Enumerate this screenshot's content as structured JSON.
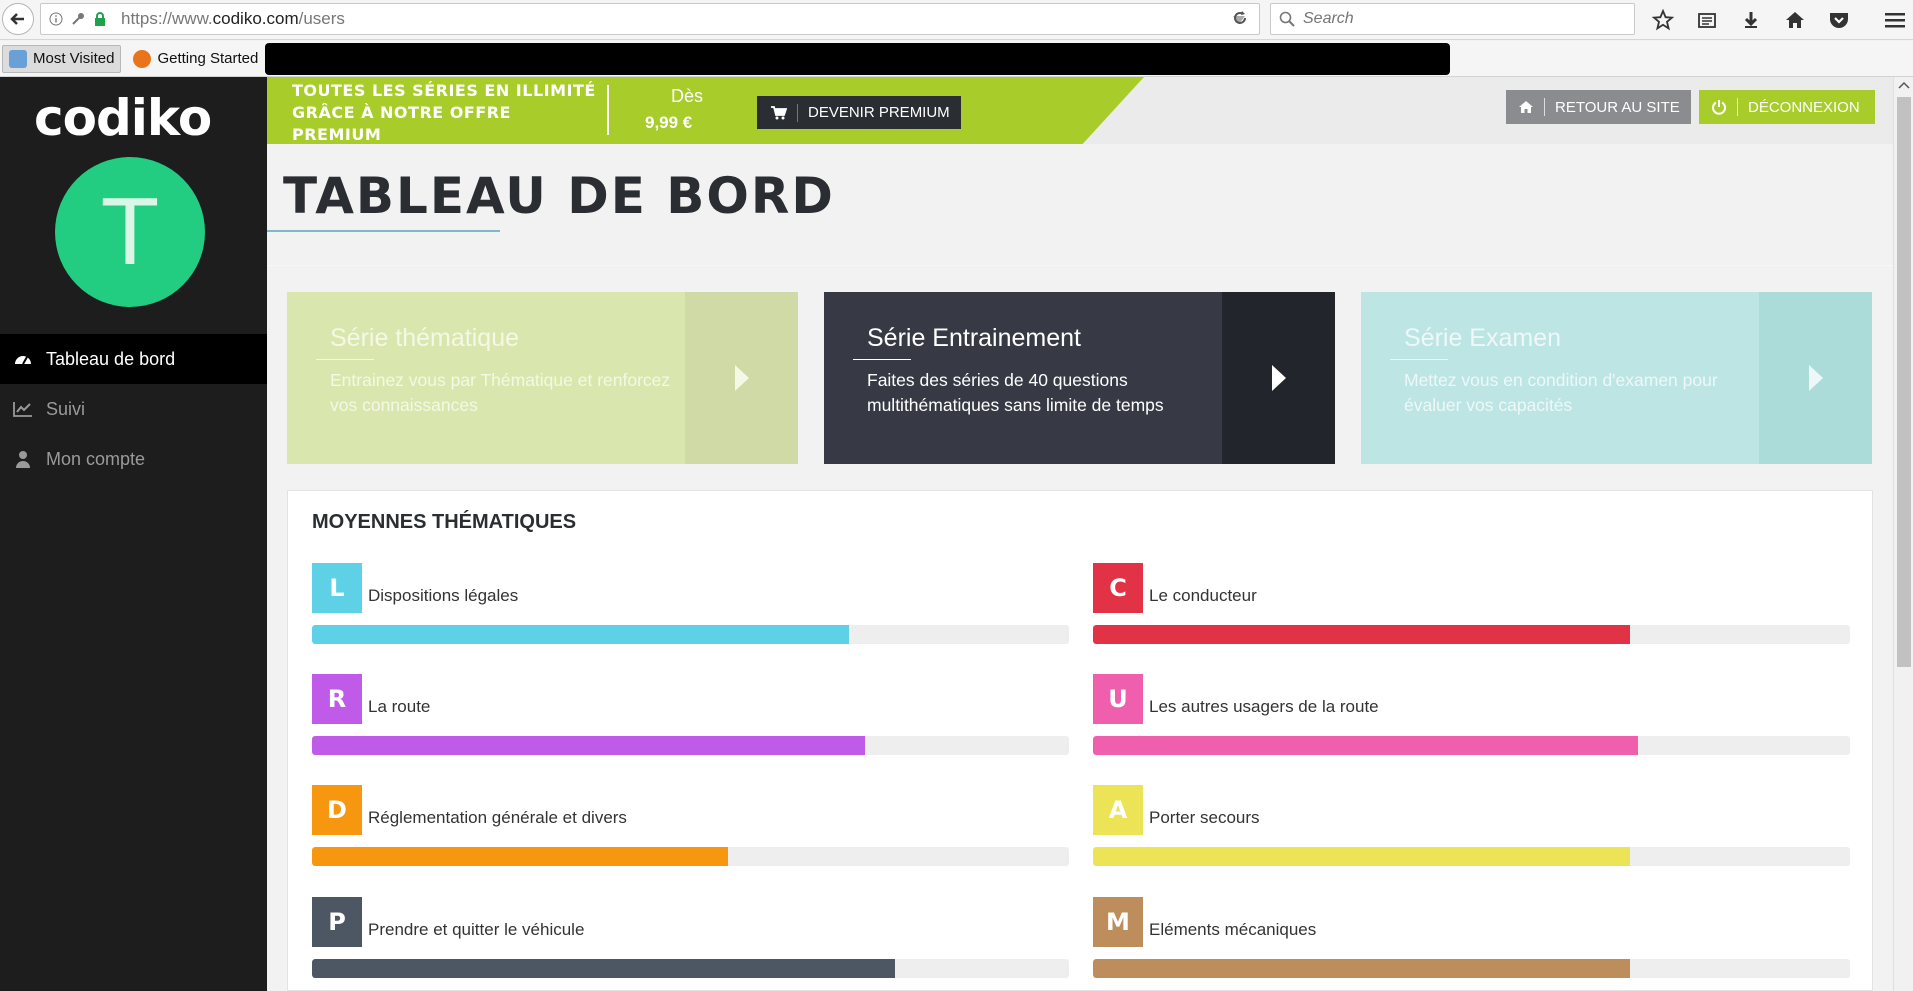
{
  "browser": {
    "url_prefix": "https://www.",
    "url_domain": "codiko.com",
    "url_path": "/users",
    "search_placeholder": "Search",
    "bookmarks": [
      "Most Visited",
      "Getting Started"
    ]
  },
  "sidebar": {
    "logo": "codiko",
    "avatar_letter": "T",
    "avatar_color": "#22cc80",
    "nav": [
      {
        "label": "Tableau de bord",
        "icon": "dashboard-icon",
        "active": true
      },
      {
        "label": "Suivi",
        "icon": "line-chart-icon",
        "active": false
      },
      {
        "label": "Mon compte",
        "icon": "user-icon",
        "active": false
      }
    ]
  },
  "promo": {
    "text": "TOUTES LES SÉRIES EN ILLIMITÉ GRÂCE À NOTRE OFFRE PREMIUM",
    "price_label": "Dès",
    "price": "9,99 €",
    "premium_button": "DEVENIR PREMIUM",
    "site_button": "RETOUR AU SITE",
    "logout_button": "DÉCONNEXION",
    "accent_color": "#a8cc2a"
  },
  "page_title": "TABLEAU DE BORD",
  "cards": [
    {
      "title": "Série thématique",
      "desc": "Entrainez vous par Thématique et renforcez vos connaissances"
    },
    {
      "title": "Série Entrainement",
      "desc": "Faites des séries de 40 questions multithématiques sans limite de temps"
    },
    {
      "title": "Série Examen",
      "desc": "Mettez vous en condition d'examen pour évaluer vos capacités"
    }
  ],
  "moyennes": {
    "title": "MOYENNES THÉMATIQUES",
    "themes": [
      {
        "letter": "L",
        "name": "Dispositions légales",
        "color": "#5ed1e6",
        "progress": 0.71
      },
      {
        "letter": "C",
        "name": "Le conducteur",
        "color": "#e13246",
        "progress": 0.71
      },
      {
        "letter": "R",
        "name": "La route",
        "color": "#c05ae8",
        "progress": 0.73
      },
      {
        "letter": "U",
        "name": "Les autres usagers de la route",
        "color": "#ef5fae",
        "progress": 0.72
      },
      {
        "letter": "D",
        "name": "Réglementation générale et divers",
        "color": "#f7960f",
        "progress": 0.55
      },
      {
        "letter": "A",
        "name": "Porter secours",
        "color": "#ece356",
        "progress": 0.71
      },
      {
        "letter": "P",
        "name": "Prendre et quitter le véhicule",
        "color": "#4d5663",
        "progress": 0.77
      },
      {
        "letter": "M",
        "name": "Eléments mécaniques",
        "color": "#bd8e5c",
        "progress": 0.71
      }
    ]
  }
}
